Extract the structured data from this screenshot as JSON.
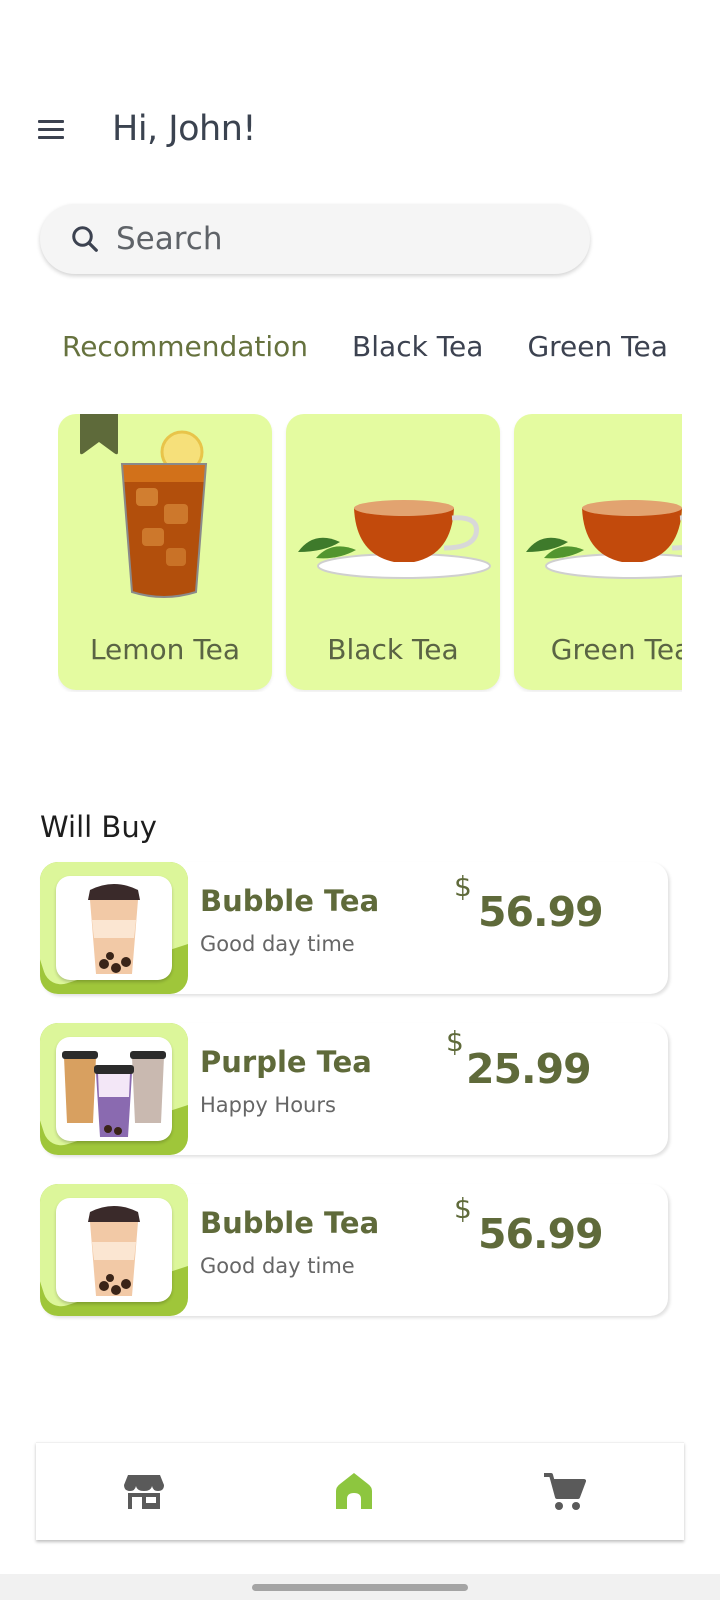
{
  "header": {
    "greeting": "Hi, John!"
  },
  "search": {
    "placeholder": "Search"
  },
  "tabs": [
    {
      "label": "Recommendation",
      "active": true
    },
    {
      "label": "Black Tea",
      "active": false
    },
    {
      "label": "Green Tea",
      "active": false
    }
  ],
  "featured": [
    {
      "label": "Lemon Tea",
      "icon": "iced-lemon-tea-image",
      "bookmarked": true
    },
    {
      "label": "Black Tea",
      "icon": "tea-cup-image"
    },
    {
      "label": "Green Tea",
      "icon": "tea-cup-image"
    }
  ],
  "will_buy": {
    "title": "Will Buy",
    "items": [
      {
        "name": "Bubble Tea",
        "subtitle": "Good day time",
        "currency": "$",
        "price": "56.99",
        "icon": "bubble-tea-image"
      },
      {
        "name": "Purple Tea",
        "subtitle": "Happy Hours",
        "currency": "$",
        "price": "25.99",
        "icon": "three-bubble-teas-image"
      },
      {
        "name": "Bubble Tea",
        "subtitle": "Good day time",
        "currency": "$",
        "price": "56.99",
        "icon": "bubble-tea-image"
      }
    ]
  },
  "nav": {
    "items": [
      {
        "icon": "store-icon",
        "active": false
      },
      {
        "icon": "home-icon",
        "active": true
      },
      {
        "icon": "cart-icon",
        "active": false
      }
    ]
  },
  "colors": {
    "accent": "#8dc63f",
    "card_bg": "#e4fba0",
    "text_green": "#5f6a3a",
    "text_dark": "#3c4250"
  }
}
